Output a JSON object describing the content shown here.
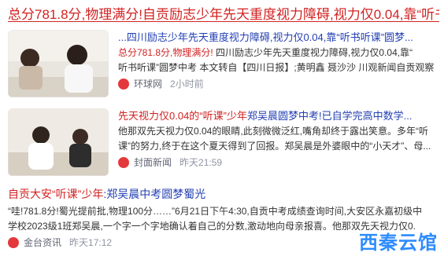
{
  "top_title": "总分781.8分,物理满分!自贡励志少年先天重度视力障碍,视力仅0.04,靠“听书",
  "results": [
    {
      "title_link": "...四川励志少年先天重度视力障碍,视力仅0.04,靠“听书听课”圆梦...",
      "desc_line1_hl": "总分781.8分,物理满分!",
      "desc_line1_rest": "四川励志少年先天重度视力障碍,视力仅0.04,靠“",
      "desc_line2": "听书听课”圆梦中考  本文转自【四川日报】;黄明鑫  聂沙沙  川观新闻自贡观察",
      "source": "环球网",
      "time": "2小时前"
    },
    {
      "title_hl": "先天视力仅0.04的",
      "title_hl2": "“听课”少年",
      "title_rest": "郑吴晨圆梦中考!",
      "title_link2": "已自学完高中数学...",
      "desc_line1": "他那双先天视力仅0.04的眼睛,此刻微微泛红,嘴角却终于露出笑意。多年“听",
      "desc_line2": "课”的努力,终于在这个夏天得到了回报。郑吴晨是外婆眼中的“小天才”、母...",
      "source": "封面新闻",
      "time": "昨天21:59"
    },
    {
      "title_hl": "自贡大安“听课”少年",
      "title_rest": ":郑吴晨中考圆梦蜀光",
      "desc_line1": "“哇!781.8分!蜀光提前批,物理100分……”6月21日下午4:30,自贡中考成绩查询时间,大安区永嘉初级中",
      "desc_line2": "学校2023级1班郑吴晨,一个字一个字地确认着自己的分数,激动地向母亲报喜。他那双先天视力仅0.",
      "source": "金台资讯",
      "time": "昨天17:12"
    }
  ],
  "watermark": "西秦云馆",
  "colors": {
    "highlight": "#d22222",
    "link": "#2440b3",
    "muted": "#9195a3"
  }
}
